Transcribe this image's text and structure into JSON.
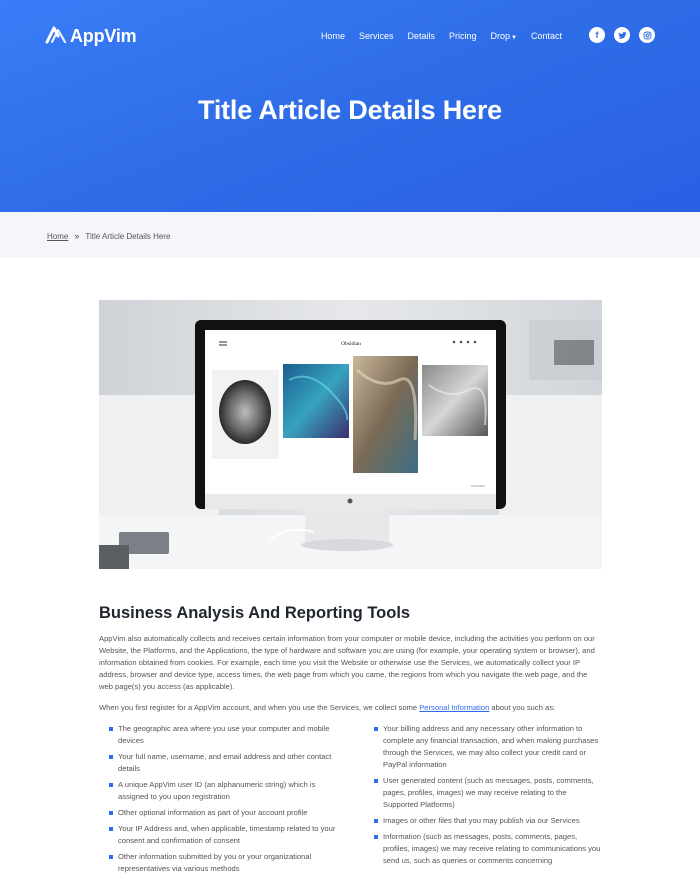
{
  "brand": {
    "name": "AppVim"
  },
  "nav": {
    "items": [
      "Home",
      "Services",
      "Details",
      "Pricing",
      "Drop",
      "Contact"
    ]
  },
  "social": [
    {
      "icon": "facebook-icon",
      "glyph": "f"
    },
    {
      "icon": "twitter-icon",
      "glyph": "t"
    },
    {
      "icon": "instagram-icon",
      "glyph": "◎"
    }
  ],
  "hero": {
    "title": "Title Article Details Here"
  },
  "breadcrumb": {
    "home": "Home",
    "separator": "»",
    "current": "Title Article Details Here"
  },
  "image": {
    "screen_brand": "Obsidian"
  },
  "article": {
    "heading": "Business Analysis And Reporting Tools",
    "paragraph1": "AppVim also automatically collects and receives certain information from your computer or mobile device, including the activities you perform on our Website, the Platforms, and the Applications, the type of hardware and software you are using (for example, your operating system or browser), and information obtained from cookies. For example, each time you visit the Website or otherwise use the Services, we automatically collect your IP address, browser and device type, access times, the web page from which you came, the regions from which you navigate the web page, and the web page(s) you access (as applicable).",
    "paragraph2_before": "When you first register for a AppVim account, and when you use the Services, we collect some ",
    "paragraph2_link": "Personal Information",
    "paragraph2_after": " about you such as:",
    "left_list": [
      "The geographic area where you use your computer and mobile devices",
      "Your full name, username, and email address and other contact details",
      "A unique AppVim user ID (an alphanumeric string) which is assigned to you upon registration",
      "Other optional information as part of your account profile",
      "Your IP Address and, when applicable, timestamp related to your consent and confirmation of consent",
      "Other information submitted by you or your organizational representatives via various methods"
    ],
    "right_list": [
      "Your billing address and any necessary other information to complete any financial transaction, and when making purchases through the Services, we may also collect your credit card or PayPal information",
      "User generated content (such as messages, posts, comments, pages, profiles, images) we may receive relating to the Supported Platforms)",
      "Images or other files that you may publish via our Services",
      "Information (such as messages, posts, comments, pages, profiles, images) we may receive relating to communications you send us, such as queries or comments concerning"
    ]
  },
  "colors": {
    "primary": "#2f6ee8",
    "hero_start": "#3a7cf7",
    "breadcrumb_bg": "#f5f6fa",
    "heading": "#1f2430"
  }
}
